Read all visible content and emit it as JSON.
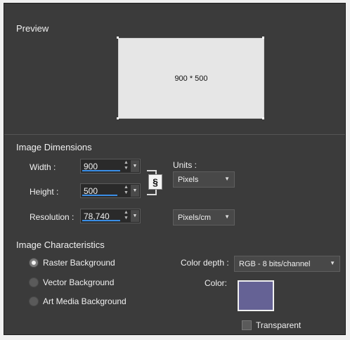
{
  "preview": {
    "title": "Preview",
    "size_text": "900 * 500"
  },
  "dimensions": {
    "title": "Image Dimensions",
    "width": {
      "label": "Width :",
      "value": "900"
    },
    "height": {
      "label": "Height :",
      "value": "500"
    },
    "resolution": {
      "label": "Resolution :",
      "value": "78,740"
    },
    "units_label": "Units :",
    "units_value": "Pixels",
    "resolution_units_value": "Pixels/cm"
  },
  "characteristics": {
    "title": "Image Characteristics",
    "options": [
      {
        "label": "Raster Background",
        "selected": true
      },
      {
        "label": "Vector Background",
        "selected": false
      },
      {
        "label": "Art Media Background",
        "selected": false
      }
    ],
    "color_depth_label": "Color depth :",
    "color_depth_value": "RGB - 8 bits/channel",
    "color_label": "Color:",
    "color_value": "#656295",
    "transparent_label": "Transparent",
    "transparent_checked": false
  }
}
